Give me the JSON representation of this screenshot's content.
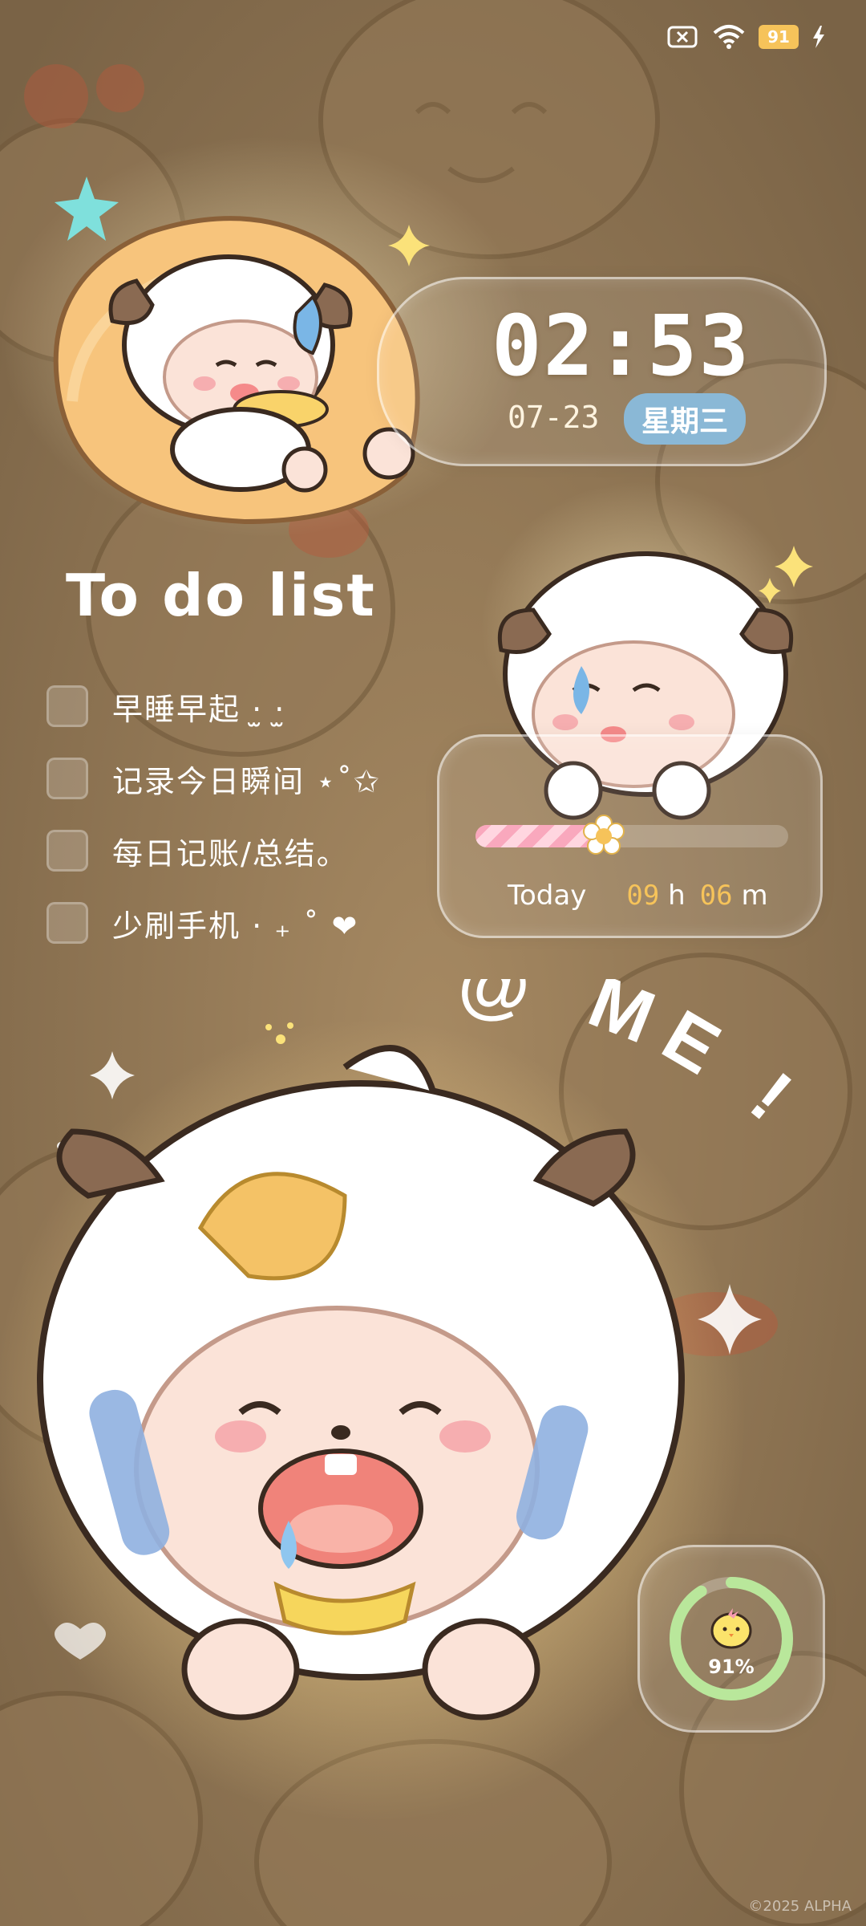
{
  "status_bar": {
    "battery_level": "91",
    "icons": [
      "no-sim-icon",
      "wifi-icon",
      "battery-icon",
      "charging-bolt-icon"
    ]
  },
  "clock": {
    "time": "02:53",
    "date": "07-23",
    "weekday": "星期三"
  },
  "todo": {
    "title": "To do list",
    "items": [
      {
        "label": "早睡早起 ·̫ ·̫",
        "checked": false
      },
      {
        "label": "记录今日瞬间 ⋆˚✩",
        "checked": false
      },
      {
        "label": "每日记账/总结。",
        "checked": false
      },
      {
        "label": "少刷手机 · ₊ ˚ ❤",
        "checked": false
      }
    ]
  },
  "screen_time": {
    "label": "Today",
    "hours": "09",
    "hours_unit": "h",
    "minutes": "06",
    "minutes_unit": "m",
    "progress": 0.41
  },
  "decor_text": "@ ME !",
  "battery_widget": {
    "percent": "91%",
    "fraction": 0.91
  },
  "copyright": "©2025 ALPHA",
  "colors": {
    "background": "#8a7153",
    "weekday_badge": "#8ab8d6",
    "accent_number": "#f6c35a",
    "progress_fill": "#f9a8bd",
    "battery_ring": "#b9e79b"
  }
}
